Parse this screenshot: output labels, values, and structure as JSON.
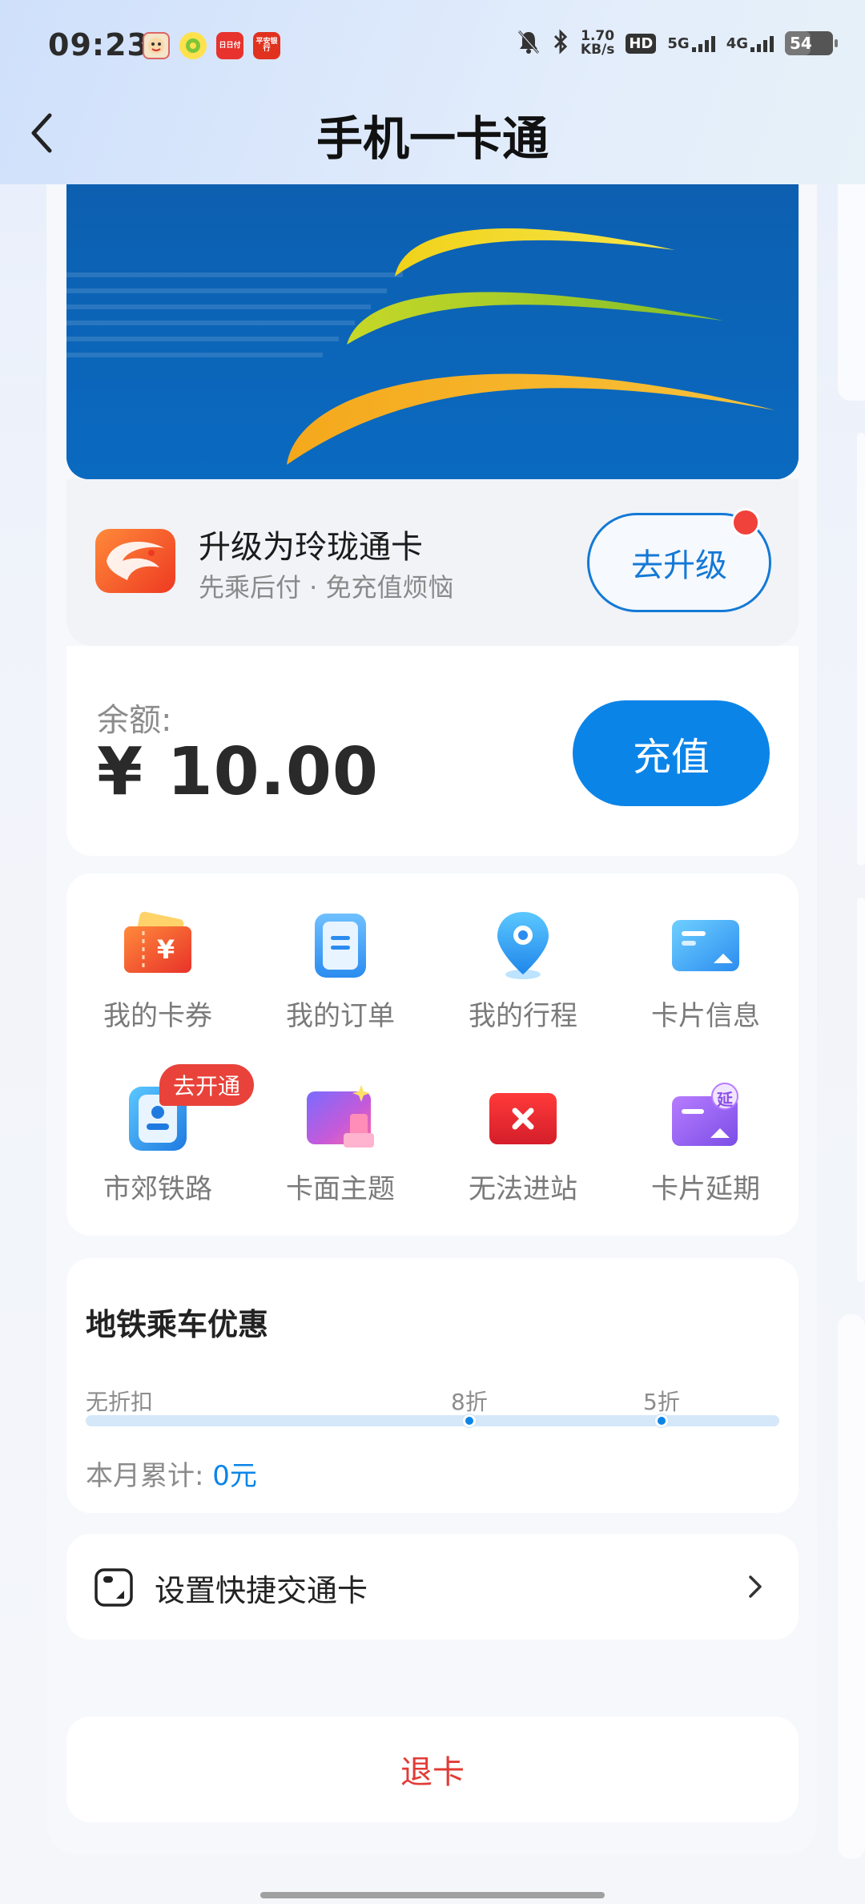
{
  "status_bar": {
    "time": "09:23",
    "net_speed_value": "1.70",
    "net_speed_unit": "KB/s",
    "hd_label": "HD",
    "sig1_label": "5G",
    "sig2_label": "4G",
    "battery_level": "54",
    "app_icons": [
      {
        "name": "app-icon-1",
        "text": ""
      },
      {
        "name": "app-icon-2",
        "text": ""
      },
      {
        "name": "app-icon-3",
        "text": "日日付"
      },
      {
        "name": "app-icon-4",
        "text": "平安银行"
      }
    ]
  },
  "header": {
    "title": "手机一卡通"
  },
  "upgrade": {
    "title": "升级为玲珑通卡",
    "subtitle": "先乘后付 · 免充值烦恼",
    "button": "去升级"
  },
  "balance": {
    "label": "余额:",
    "value": "¥ 10.00",
    "recharge_button": "充值"
  },
  "services": [
    {
      "label": "我的卡券",
      "icon": "coupon-icon"
    },
    {
      "label": "我的订单",
      "icon": "order-icon"
    },
    {
      "label": "我的行程",
      "icon": "location-pin-icon"
    },
    {
      "label": "卡片信息",
      "icon": "card-info-icon"
    },
    {
      "label": "市郊铁路",
      "icon": "suburban-rail-icon",
      "badge": "去开通"
    },
    {
      "label": "卡面主题",
      "icon": "card-theme-icon"
    },
    {
      "label": "无法进站",
      "icon": "cannot-enter-icon"
    },
    {
      "label": "卡片延期",
      "icon": "card-extend-icon",
      "icon_text": "延"
    }
  ],
  "metro_discount": {
    "title": "地铁乘车优惠",
    "tiers": [
      "无折扣",
      "8折",
      "5折"
    ],
    "cumulative_label": "本月累计: ",
    "cumulative_value": "0元",
    "progress": 0
  },
  "shortcut": {
    "label": "设置快捷交通卡"
  },
  "return_card": {
    "label": "退卡"
  },
  "colors": {
    "accent": "#0b84e8",
    "danger": "#e23b36",
    "badge": "#e8423a"
  }
}
